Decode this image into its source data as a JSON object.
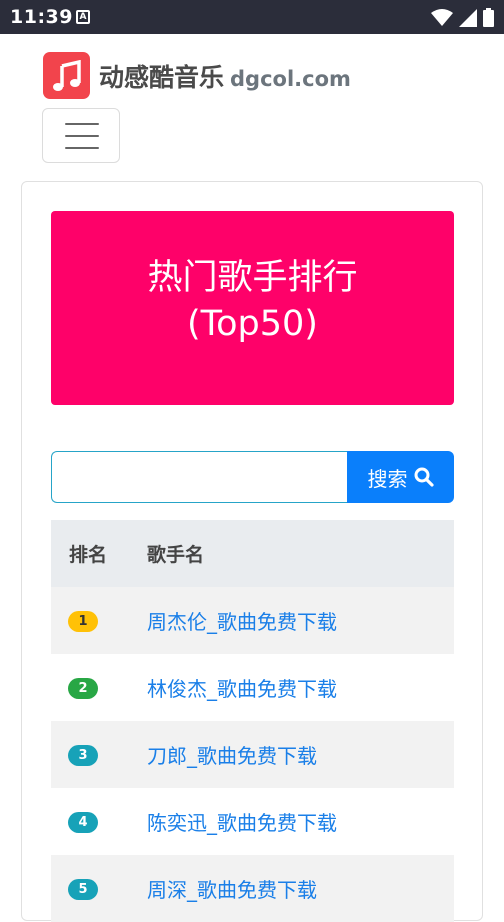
{
  "statusbar": {
    "time": "11:39",
    "notification_letter": "A"
  },
  "brand": {
    "name_cn": "动感酷音乐",
    "domain": "dgcol.com"
  },
  "hero": {
    "line1": "热门歌手排行",
    "line2": "(Top50)",
    "color": "#fe0169"
  },
  "search": {
    "value": "",
    "button_label": "搜索"
  },
  "table": {
    "headers": {
      "rank": "排名",
      "name": "歌手名"
    },
    "rows": [
      {
        "rank": "1",
        "name": "周杰伦_歌曲免费下载",
        "badge_color": "#ffc107"
      },
      {
        "rank": "2",
        "name": "林俊杰_歌曲免费下载",
        "badge_color": "#28a745"
      },
      {
        "rank": "3",
        "name": "刀郎_歌曲免费下载",
        "badge_color": "#17a2b8"
      },
      {
        "rank": "4",
        "name": "陈奕迅_歌曲免费下载",
        "badge_color": "#17a2b8"
      },
      {
        "rank": "5",
        "name": "周深_歌曲免费下载",
        "badge_color": "#17a2b8"
      }
    ]
  },
  "colors": {
    "accent": "#0a7ffb",
    "link": "#1a7fe8",
    "statusbar": "#2b2d3a"
  },
  "icons": [
    "music-note-icon",
    "hamburger-menu-icon",
    "search-icon",
    "wifi-icon",
    "cell-signal-icon",
    "battery-icon"
  ]
}
